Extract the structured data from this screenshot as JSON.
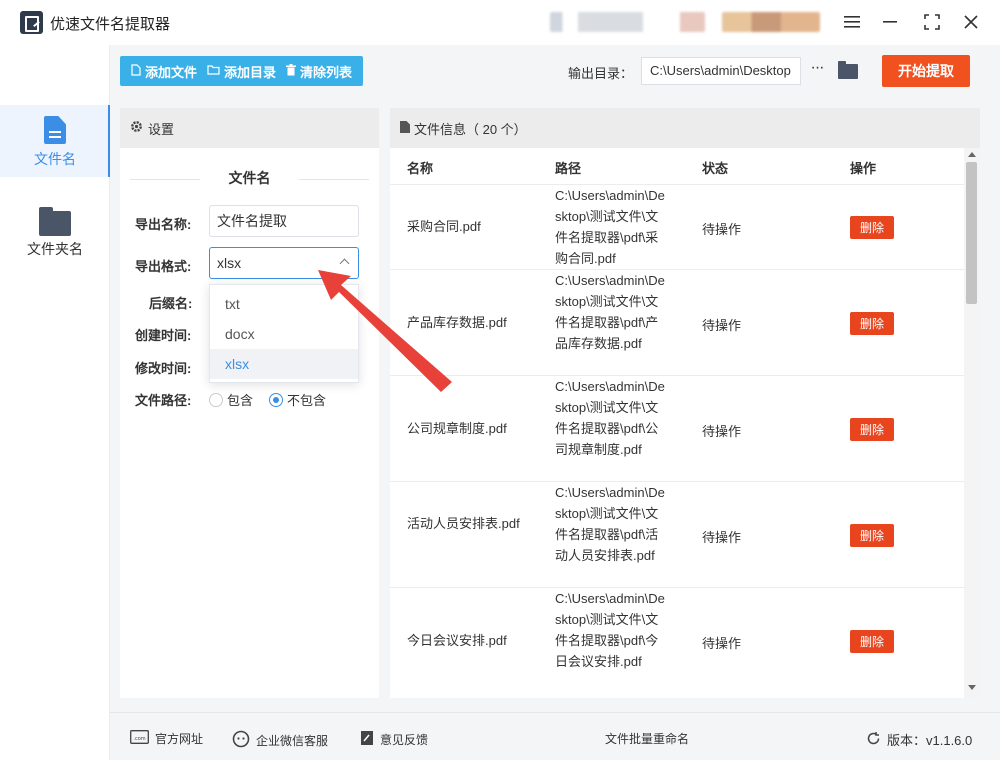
{
  "window": {
    "title": "优速文件名提取器"
  },
  "nav": {
    "items": [
      {
        "label": "文件名",
        "icon": "file-icon"
      },
      {
        "label": "文件夹名",
        "icon": "folder-icon"
      }
    ]
  },
  "toolbar": {
    "add_file": "添加文件",
    "add_dir": "添加目录",
    "clear_list": "清除列表",
    "output_label": "输出目录：",
    "output_path": "C:\\Users\\admin\\Desktop",
    "more": "···",
    "start": "开始提取"
  },
  "settings": {
    "header": "设置",
    "section_title": "文件名",
    "export_name_label": "导出名称:",
    "export_name_value": "文件名提取",
    "export_format_label": "导出格式:",
    "export_format_value": "xlsx",
    "format_options": [
      "txt",
      "docx",
      "xlsx"
    ],
    "suffix_label": "后缀名:",
    "created_label": "创建时间:",
    "modified_label": "修改时间:",
    "path_label": "文件路径:",
    "path_include": "包含",
    "path_exclude": "不包含"
  },
  "files": {
    "header": "文件信息（ 20 个）",
    "columns": [
      "名称",
      "路径",
      "状态",
      "操作"
    ],
    "rows": [
      {
        "name": "采购合同.pdf",
        "path": "C:\\Users\\admin\\Desktop\\测试文件\\文件名提取器\\pdf\\采购合同.pdf",
        "status": "待操作",
        "action": "删除"
      },
      {
        "name": "产品库存数据.pdf",
        "path": "C:\\Users\\admin\\Desktop\\测试文件\\文件名提取器\\pdf\\产品库存数据.pdf",
        "status": "待操作",
        "action": "删除"
      },
      {
        "name": "公司规章制度.pdf",
        "path": "C:\\Users\\admin\\Desktop\\测试文件\\文件名提取器\\pdf\\公司规章制度.pdf",
        "status": "待操作",
        "action": "删除"
      },
      {
        "name": "活动人员安排表.pdf",
        "path": "C:\\Users\\admin\\Desktop\\测试文件\\文件名提取器\\pdf\\活动人员安排表.pdf",
        "status": "待操作",
        "action": "删除"
      },
      {
        "name": "今日会议安排.pdf",
        "path": "C:\\Users\\admin\\Desktop\\测试文件\\文件名提取器\\pdf\\今日会议安排.pdf",
        "status": "待操作",
        "action": "删除"
      }
    ]
  },
  "footer": {
    "website": "官方网址",
    "wechat": "企业微信客服",
    "feedback": "意见反馈",
    "rename": "文件批量重命名",
    "version": "版本：v1.1.6.0"
  },
  "colors": {
    "accent": "#3a8ee6",
    "toolbar_button": "#3ab0e8",
    "start_button": "#f1501f",
    "delete_button": "#e8451f",
    "arrow": "#e8413a"
  }
}
